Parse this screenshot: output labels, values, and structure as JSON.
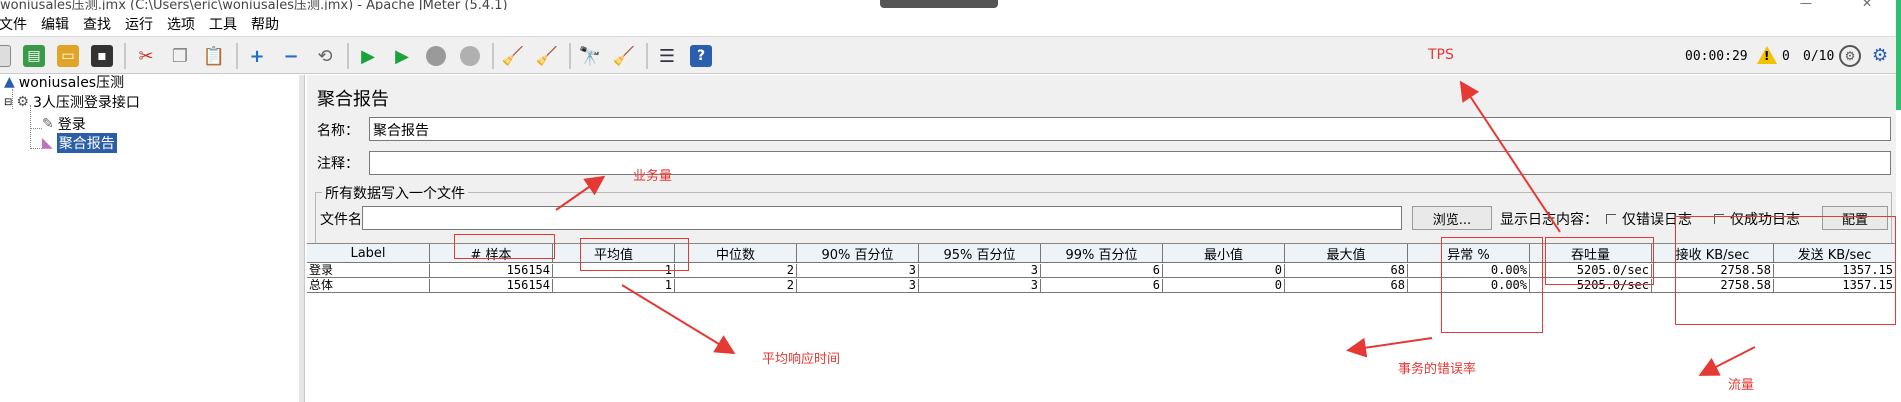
{
  "window": {
    "title": "woniusales压测.jmx (C:\\Users\\eric\\woniusales压测.jmx) - Apache JMeter (5.4.1)"
  },
  "menu": [
    "文件",
    "编辑",
    "查找",
    "运行",
    "选项",
    "工具",
    "帮助"
  ],
  "status": {
    "timer": "00:00:29",
    "warnings": "0",
    "threads": "0/10"
  },
  "tree": {
    "root": "woniusales压测",
    "group": "3人压测登录接口",
    "sampler": "登录",
    "listener": "聚合报告"
  },
  "panel": {
    "title": "聚合报告",
    "name_label": "名称：",
    "name_value": "聚合报告",
    "comment_label": "注释：",
    "comment_value": "",
    "file_section": "所有数据写入一个文件",
    "filename_label": "文件名",
    "filename_value": "",
    "browse_button": "浏览...",
    "log_label": "显示日志内容：",
    "error_only": "仅错误日志",
    "success_only": "仅成功日志",
    "config_button": "配置"
  },
  "table": {
    "columns": [
      "Label",
      "# 样本",
      "平均值",
      "中位数",
      "90% 百分位",
      "95% 百分位",
      "99% 百分位",
      "最小值",
      "最大值",
      "异常 %",
      "吞吐量",
      "接收 KB/sec",
      "发送 KB/sec"
    ],
    "rows": [
      [
        "登录",
        "156154",
        "1",
        "2",
        "3",
        "3",
        "6",
        "0",
        "68",
        "0.00%",
        "5205.0/sec",
        "2758.58",
        "1357.15"
      ],
      [
        "总体",
        "156154",
        "1",
        "2",
        "3",
        "3",
        "6",
        "0",
        "68",
        "0.00%",
        "5205.0/sec",
        "2758.58",
        "1357.15"
      ]
    ]
  },
  "annotations": {
    "tps": "TPS",
    "volume": "业务量",
    "avg_time": "平均响应时间",
    "error_rate": "事务的错误率",
    "traffic": "流量"
  },
  "colors": {
    "annotation": "#e53935",
    "selection": "#2b5ea8"
  }
}
